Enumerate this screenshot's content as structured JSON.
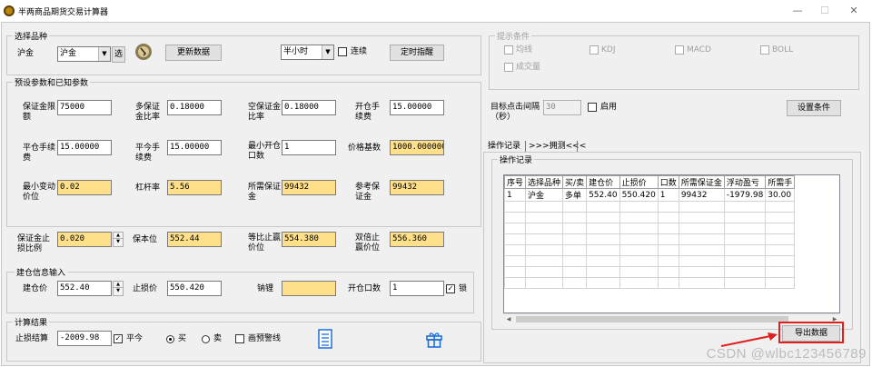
{
  "window": {
    "title": "半两商品期货交易计算器"
  },
  "select_group": {
    "title": "选择品种",
    "product_label": "沪金",
    "product_value": "沪金",
    "pick_button": "选",
    "update_button": "更新数据",
    "interval_value": "半小时",
    "continuous_label": "连续",
    "timed_button": "定时指醒"
  },
  "params_group": {
    "title": "预设参数和已知参数",
    "margin_limit_label": "保证金限额",
    "margin_limit_value": "75000",
    "long_margin_label": "多保证金比率",
    "long_margin_value": "0.18000",
    "short_margin_label": "空保证金比率",
    "short_margin_value": "0.18000",
    "open_fee_label": "开仓手续费",
    "open_fee_value": "15.00000",
    "close_fee_label": "平仓手续费",
    "close_fee_value": "15.00000",
    "close_today_fee_label": "平今手续费",
    "close_today_fee_value": "15.00000",
    "min_lots_label": "最小开仓口数",
    "min_lots_value": "1",
    "price_base_label": "价格基数",
    "price_base_value": "1000.000000",
    "min_tick_label": "最小变动价位",
    "min_tick_value": "0.02",
    "leverage_label": "杠杆率",
    "leverage_value": "5.56",
    "required_margin_label": "所需保证金",
    "required_margin_value": "99432",
    "ref_margin_label": "参考保证金",
    "ref_margin_value": "99432"
  },
  "stops": {
    "margin_stop_label": "保证金止损比例",
    "margin_stop_value": "0.020",
    "breakeven_label": "保本位",
    "breakeven_value": "552.44",
    "ratio_stop_label": "等比止赢价位",
    "ratio_stop_value": "554.380",
    "double_stop_label": "双倍止赢价位",
    "double_stop_value": "556.360"
  },
  "position_group": {
    "title": "建仓信息输入",
    "open_price_label": "建仓价",
    "open_price_value": "552.40",
    "stop_price_label": "止损价",
    "stop_price_value": "550.420",
    "anchor_label": "钠锂",
    "anchor_value": "",
    "lots_label": "开仓口数",
    "lots_value": "1",
    "lock_label": "锁"
  },
  "result_group": {
    "title": "计算结果",
    "stop_result_label": "止损结算",
    "stop_result_value": "-2009.98",
    "close_today_label": "平今",
    "buy_label": "买",
    "sell_label": "卖",
    "warn_label": "画预警线"
  },
  "hint_group": {
    "title": "提示条件",
    "options": [
      "均线",
      "KDJ",
      "MACD",
      "BOLL",
      "成交量"
    ]
  },
  "target": {
    "label": "目标点击间隔（秒）",
    "value": "30",
    "enable_label": "启用",
    "set_button": "设置条件"
  },
  "tabs": {
    "active": "操作记录",
    "inactive": ">>>拥测<<<"
  },
  "log": {
    "title": "操作记录",
    "columns": [
      "序号",
      "选择品种",
      "买/卖",
      "建仓价",
      "止损价",
      "口数",
      "所需保证金",
      "浮动盈亏",
      "所需手"
    ],
    "rows": [
      [
        "1",
        "沪金",
        "多单",
        "552.40",
        "550.420",
        "1",
        "99432",
        "-1979.98",
        "30.00"
      ]
    ],
    "export_button": "导出数据"
  },
  "watermark": "CSDN @wlbc123456789",
  "colors": {
    "highlight_field": "#ffe08a",
    "annotation_red": "#e02020",
    "icon_blue": "#1e6fd9"
  }
}
